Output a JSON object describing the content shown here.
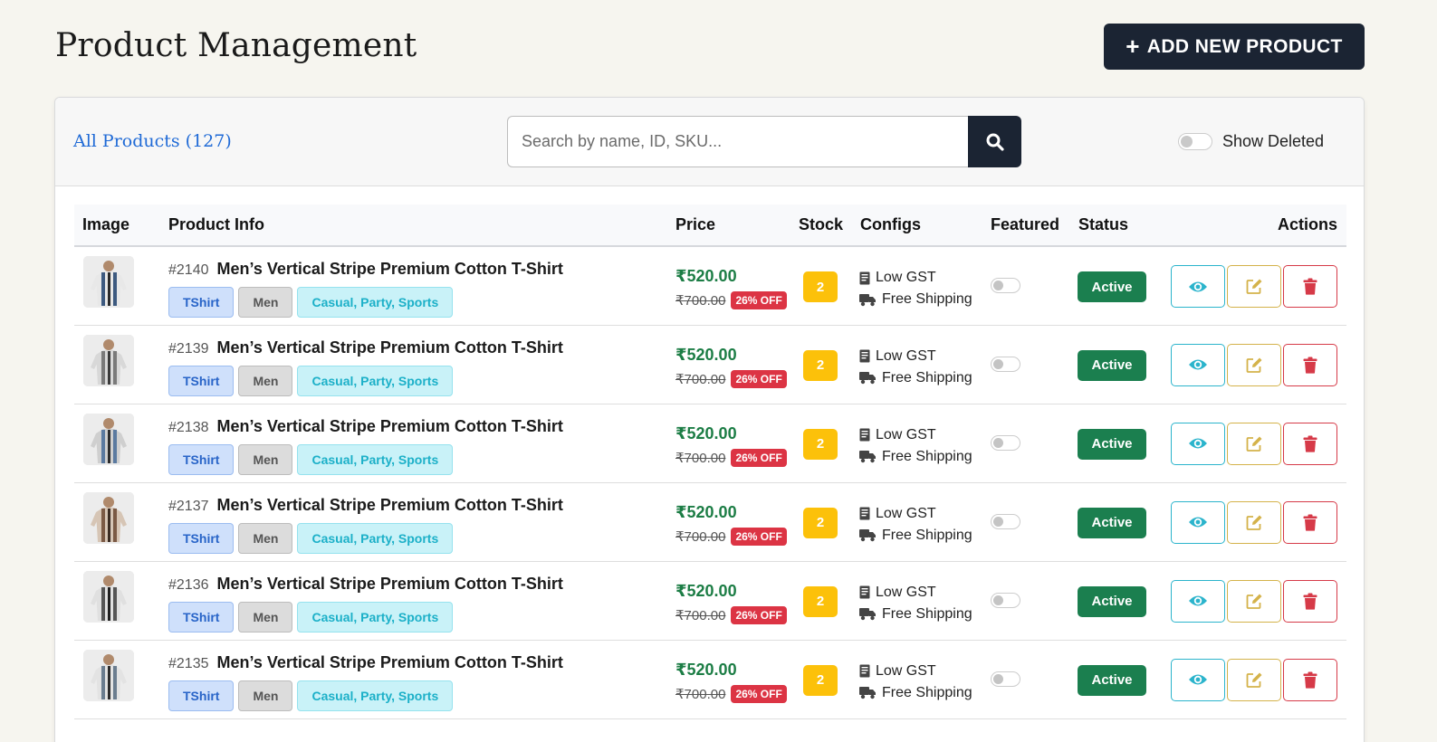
{
  "header": {
    "title": "Product Management",
    "add_button_label": "ADD NEW PRODUCT"
  },
  "toolbar": {
    "all_products_label": "All Products (127)",
    "search_placeholder": "Search by name, ID, SKU...",
    "show_deleted_label": "Show Deleted"
  },
  "columns": {
    "image": "Image",
    "info": "Product Info",
    "price": "Price",
    "stock": "Stock",
    "configs": "Configs",
    "featured": "Featured",
    "status": "Status",
    "actions": "Actions"
  },
  "colors": {
    "accent_dark": "#1b2433",
    "price_green": "#1c7d45",
    "discount_red": "#dc3444",
    "stock_yellow": "#fcc10a",
    "status_green": "#1b7f4f"
  },
  "icons": {
    "add": "plus-icon",
    "search": "search-icon",
    "gst": "receipt-icon",
    "shipping": "truck-icon",
    "view": "eye-icon",
    "edit": "edit-icon",
    "delete": "trash-icon"
  },
  "products": [
    {
      "id": "#2140",
      "name": "Men’s Vertical Stripe Premium Cotton T-Shirt",
      "category": "TShirt",
      "gender": "Men",
      "occasion": "Casual, Party, Sports",
      "price": "₹520.00",
      "old_price": "₹700.00",
      "discount": "26% OFF",
      "stock": "2",
      "gst": "Low GST",
      "shipping": "Free Shipping",
      "featured": false,
      "status": "Active"
    },
    {
      "id": "#2139",
      "name": "Men’s Vertical Stripe Premium Cotton T-Shirt",
      "category": "TShirt",
      "gender": "Men",
      "occasion": "Casual, Party, Sports",
      "price": "₹520.00",
      "old_price": "₹700.00",
      "discount": "26% OFF",
      "stock": "2",
      "gst": "Low GST",
      "shipping": "Free Shipping",
      "featured": false,
      "status": "Active"
    },
    {
      "id": "#2138",
      "name": "Men’s Vertical Stripe Premium Cotton T-Shirt",
      "category": "TShirt",
      "gender": "Men",
      "occasion": "Casual, Party, Sports",
      "price": "₹520.00",
      "old_price": "₹700.00",
      "discount": "26% OFF",
      "stock": "2",
      "gst": "Low GST",
      "shipping": "Free Shipping",
      "featured": false,
      "status": "Active"
    },
    {
      "id": "#2137",
      "name": "Men’s Vertical Stripe Premium Cotton T-Shirt",
      "category": "TShirt",
      "gender": "Men",
      "occasion": "Casual, Party, Sports",
      "price": "₹520.00",
      "old_price": "₹700.00",
      "discount": "26% OFF",
      "stock": "2",
      "gst": "Low GST",
      "shipping": "Free Shipping",
      "featured": false,
      "status": "Active"
    },
    {
      "id": "#2136",
      "name": "Men’s Vertical Stripe Premium Cotton T-Shirt",
      "category": "TShirt",
      "gender": "Men",
      "occasion": "Casual, Party, Sports",
      "price": "₹520.00",
      "old_price": "₹700.00",
      "discount": "26% OFF",
      "stock": "2",
      "gst": "Low GST",
      "shipping": "Free Shipping",
      "featured": false,
      "status": "Active"
    },
    {
      "id": "#2135",
      "name": "Men’s Vertical Stripe Premium Cotton T-Shirt",
      "category": "TShirt",
      "gender": "Men",
      "occasion": "Casual, Party, Sports",
      "price": "₹520.00",
      "old_price": "₹700.00",
      "discount": "26% OFF",
      "stock": "2",
      "gst": "Low GST",
      "shipping": "Free Shipping",
      "featured": false,
      "status": "Active"
    }
  ]
}
